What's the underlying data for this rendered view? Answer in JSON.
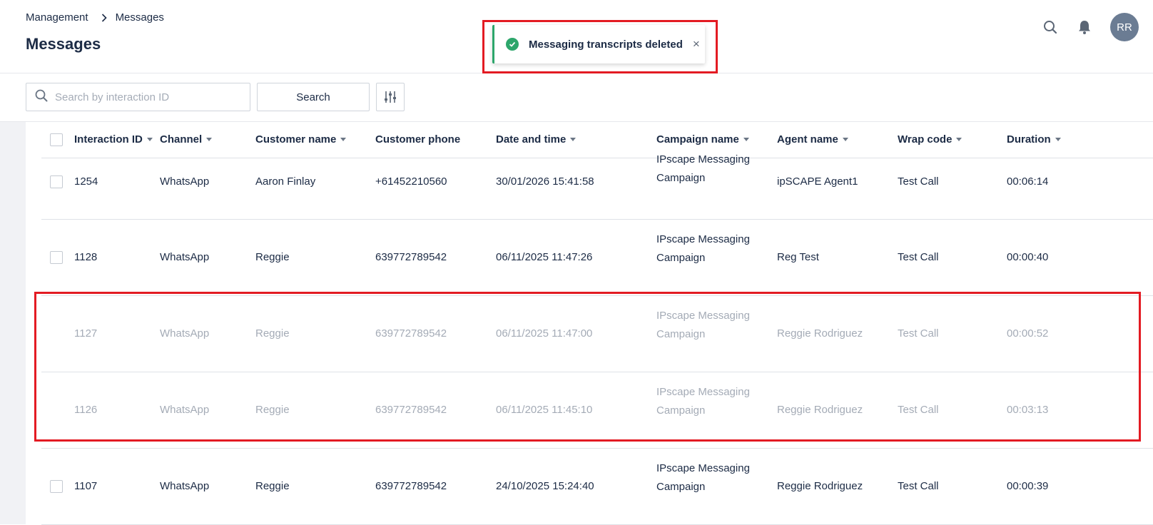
{
  "breadcrumb": {
    "parent": "Management",
    "current": "Messages"
  },
  "page_title": "Messages",
  "toast": {
    "message": "Messaging transcripts deleted",
    "close": "×",
    "color": "#2da66b"
  },
  "user": {
    "initials": "RR"
  },
  "search": {
    "placeholder": "Search by interaction ID",
    "value": "",
    "button": "Search"
  },
  "columns": [
    "Interaction ID",
    "Channel",
    "Customer name",
    "Customer phone",
    "Date and time",
    "Campaign name",
    "Agent name",
    "Wrap code",
    "Duration"
  ],
  "rows": [
    {
      "id": "1254",
      "channel": "WhatsApp",
      "customer": "Aaron Finlay",
      "phone": "+61452210560",
      "datetime": "30/01/2026 15:41:58",
      "campaign_l1": "IPscape Messaging",
      "campaign_l2": "Campaign",
      "agent": "ipSCAPE Agent1",
      "wrap": "Test Call",
      "duration": "00:06:14",
      "deleted": false
    },
    {
      "id": "1128",
      "channel": "WhatsApp",
      "customer": "Reggie",
      "phone": "639772789542",
      "datetime": "06/11/2025 11:47:26",
      "campaign_l1": "IPscape Messaging",
      "campaign_l2": "Campaign",
      "agent": "Reg Test",
      "wrap": "Test Call",
      "duration": "00:00:40",
      "deleted": false
    },
    {
      "id": "1127",
      "channel": "WhatsApp",
      "customer": "Reggie",
      "phone": "639772789542",
      "datetime": "06/11/2025 11:47:00",
      "campaign_l1": "IPscape Messaging",
      "campaign_l2": "Campaign",
      "agent": "Reggie Rodriguez",
      "wrap": "Test Call",
      "duration": "00:00:52",
      "deleted": true
    },
    {
      "id": "1126",
      "channel": "WhatsApp",
      "customer": "Reggie",
      "phone": "639772789542",
      "datetime": "06/11/2025 11:45:10",
      "campaign_l1": "IPscape Messaging",
      "campaign_l2": "Campaign",
      "agent": "Reggie Rodriguez",
      "wrap": "Test Call",
      "duration": "00:03:13",
      "deleted": true
    },
    {
      "id": "1107",
      "channel": "WhatsApp",
      "customer": "Reggie",
      "phone": "639772789542",
      "datetime": "24/10/2025 15:24:40",
      "campaign_l1": "IPscape Messaging",
      "campaign_l2": "Campaign",
      "agent": "Reggie Rodriguez",
      "wrap": "Test Call",
      "duration": "00:00:39",
      "deleted": false
    }
  ],
  "colors": {
    "highlight": "#e31b23",
    "success": "#2da66b",
    "text": "#1c2b45",
    "muted": "#a4abb6"
  },
  "icons": [
    "chevron-right-icon",
    "check-circle-icon",
    "close-icon",
    "search-icon",
    "bell-icon",
    "filter-sliders-icon",
    "sort-caret-icon"
  ]
}
